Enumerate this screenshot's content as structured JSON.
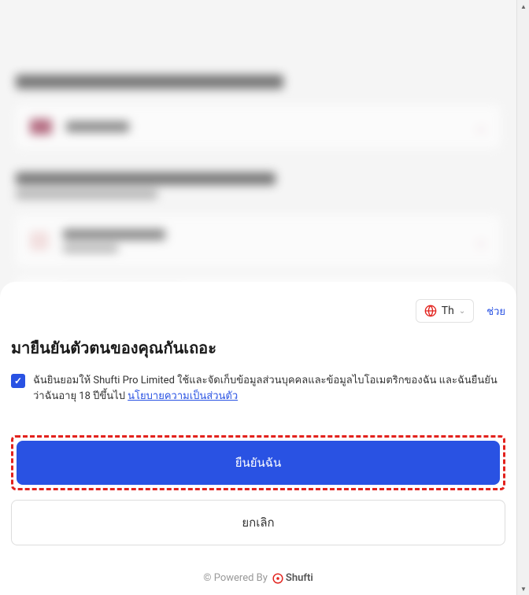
{
  "sheet": {
    "language": {
      "label": "Th"
    },
    "help_link": "ช่วย",
    "title": "มายืนยันตัวตนของคุณกันเถอะ",
    "consent": {
      "text_prefix": "ฉันยินยอมให้ Shufti Pro Limited ใช้และจัดเก็บข้อมูลส่วนบุคคลและข้อมูลไบโอเมตริกของฉัน และฉันยืนยันว่าฉันอายุ 18 ปีขึ้นไป ",
      "privacy_link": "นโยบายความเป็นส่วนตัว"
    },
    "primary_button": "ยืนยันฉัน",
    "secondary_button": "ยกเลิก",
    "powered_by": "© Powered By",
    "brand": "Shufti"
  }
}
